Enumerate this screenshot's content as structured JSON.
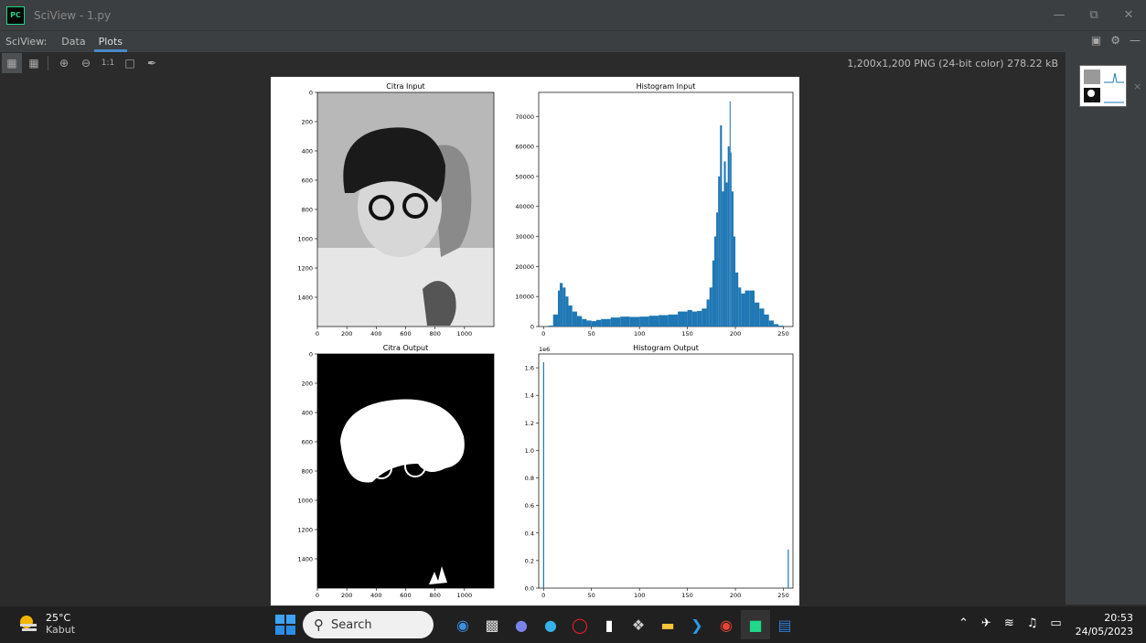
{
  "window": {
    "title": "SciView - 1.py",
    "logo": "PC"
  },
  "window_controls": {
    "minimize": "—",
    "restore": "⧉",
    "close": "✕"
  },
  "tabs": {
    "label": "SciView:",
    "items": [
      {
        "label": "Data"
      },
      {
        "label": "Plots"
      }
    ]
  },
  "image_info": "1,200x1,200 PNG (24-bit color) 278.22 kB",
  "plot": {
    "panels": [
      {
        "title": "Citra Input",
        "xticks": [
          "0",
          "200",
          "400",
          "600",
          "800",
          "1000"
        ],
        "yticks": [
          "0",
          "200",
          "400",
          "600",
          "800",
          "1000",
          "1200",
          "1400"
        ]
      },
      {
        "title": "Histogram Input",
        "xticks": [
          "0",
          "50",
          "100",
          "150",
          "200",
          "250"
        ],
        "yticks": [
          "0",
          "10000",
          "20000",
          "30000",
          "40000",
          "50000",
          "60000",
          "70000"
        ]
      },
      {
        "title": "Citra Output",
        "xticks": [
          "0",
          "200",
          "400",
          "600",
          "800",
          "1000"
        ],
        "yticks": [
          "0",
          "200",
          "400",
          "600",
          "800",
          "1000",
          "1200",
          "1400"
        ]
      },
      {
        "title": "Histogram Output",
        "offset_label": "1e6",
        "xticks": [
          "0",
          "50",
          "100",
          "150",
          "200",
          "250"
        ],
        "yticks": [
          "0.0",
          "0.2",
          "0.4",
          "0.6",
          "0.8",
          "1.0",
          "1.2",
          "1.4",
          "1.6"
        ]
      }
    ]
  },
  "chart_data": [
    {
      "type": "bar",
      "title": "Histogram Input",
      "xlim": [
        -5,
        260
      ],
      "ylim": [
        0,
        78000
      ],
      "x": [
        0,
        5,
        10,
        15,
        17,
        20,
        23,
        26,
        30,
        35,
        40,
        45,
        50,
        55,
        60,
        70,
        80,
        90,
        100,
        110,
        120,
        130,
        140,
        150,
        155,
        160,
        165,
        170,
        173,
        176,
        178,
        180,
        182,
        184,
        186,
        188,
        190,
        192,
        194,
        195,
        196,
        198,
        200,
        203,
        206,
        210,
        215,
        220,
        225,
        230,
        235,
        240,
        245,
        250
      ],
      "values": [
        0,
        300,
        4000,
        12000,
        14500,
        13000,
        10000,
        7000,
        5000,
        3500,
        2500,
        2000,
        1800,
        2200,
        2500,
        3000,
        3300,
        3200,
        3300,
        3600,
        3800,
        4000,
        5000,
        5500,
        5000,
        5200,
        6000,
        9000,
        13000,
        22000,
        30000,
        38000,
        50000,
        67000,
        45000,
        55000,
        48000,
        60000,
        75000,
        58000,
        45000,
        30000,
        18000,
        13000,
        11000,
        12000,
        12000,
        8000,
        6000,
        4000,
        2000,
        800,
        300,
        0
      ]
    },
    {
      "type": "bar",
      "title": "Histogram Output",
      "xlim": [
        -5,
        260
      ],
      "ylim": [
        0,
        1700000
      ],
      "x": [
        0,
        255
      ],
      "values": [
        1640000,
        280000
      ]
    }
  ],
  "thumbnail_close": "×",
  "taskbar": {
    "weather": {
      "temp": "25°C",
      "desc": "Kabut"
    },
    "search_label": "Search",
    "clock": {
      "time": "20:53",
      "date": "24/05/2023"
    }
  },
  "colors": {
    "bar": "#1f77b4",
    "accent": "#4a88c7"
  }
}
